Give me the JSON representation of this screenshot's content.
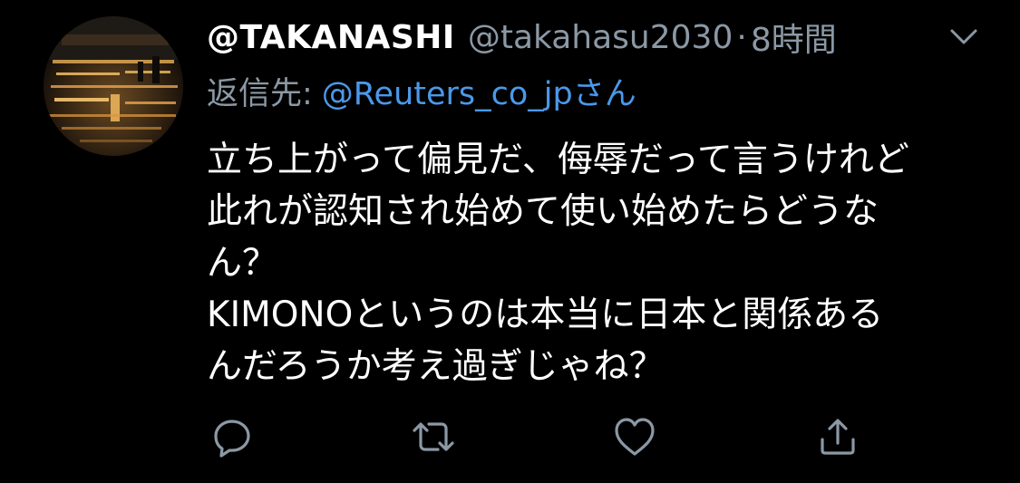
{
  "tweet": {
    "display_name": "@TAKANASHI",
    "handle": "@takahasu2030",
    "separator": "·",
    "time": "8時間",
    "reply_to_label": "返信先:",
    "reply_to_handle": "@Reuters_co_jpさん",
    "body_lines": [
      "立ち上がって偏見だ、侮辱だって言うけれど",
      "此れが認知され始めて使い始めたらどうな",
      "ん？",
      "KIMONOというのは本当に日本と関係ある",
      "んだろうか考え過ぎじゃね？"
    ]
  },
  "icons": {
    "more": "chevron-down-icon",
    "reply": "comment-icon",
    "retweet": "retweet-icon",
    "like": "heart-icon",
    "share": "share-icon"
  },
  "colors": {
    "background": "#000000",
    "text_primary": "#ffffff",
    "text_secondary": "#8b98a5",
    "link": "#4a99e9"
  }
}
